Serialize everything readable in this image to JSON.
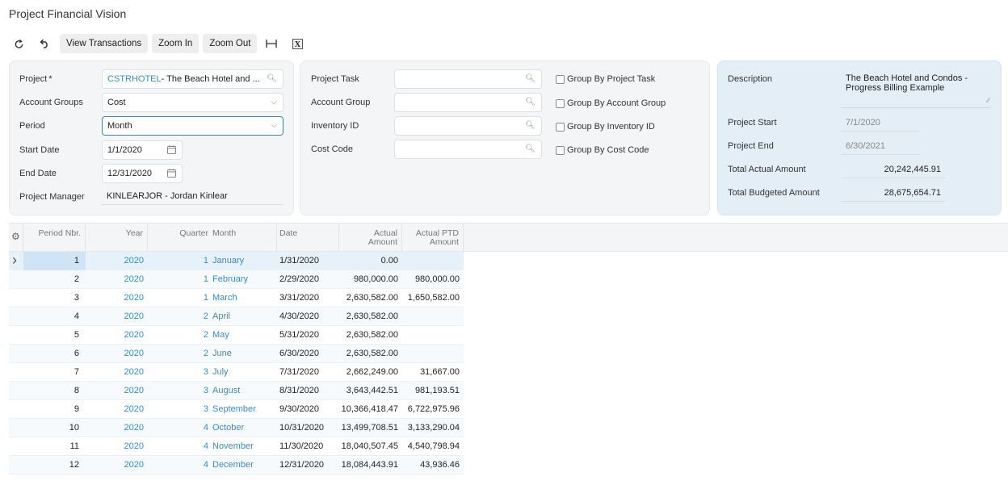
{
  "page": {
    "title": "Project Financial Vision"
  },
  "toolbar": {
    "refresh_icon": "refresh-icon",
    "undo_icon": "undo-icon",
    "view_transactions": "View Transactions",
    "zoom_in": "Zoom In",
    "zoom_out": "Zoom Out",
    "fit_icon": "fit-width-icon",
    "excel_icon": "excel-export-icon"
  },
  "filters": {
    "project": {
      "label": "Project",
      "required_mark": "*",
      "code": "CSTRHOTEL",
      "desc": " - The Beach Hotel and ...",
      "icon": "search-icon"
    },
    "account_groups": {
      "label": "Account Groups",
      "value": "Cost"
    },
    "period": {
      "label": "Period",
      "value": "Month"
    },
    "start_date": {
      "label": "Start Date",
      "value": "1/1/2020"
    },
    "end_date": {
      "label": "End Date",
      "value": "12/31/2020"
    },
    "project_manager": {
      "label": "Project Manager",
      "value": "KINLEARJOR - Jordan Kinlear"
    }
  },
  "lookups": {
    "project_task": {
      "label": "Project Task",
      "value": "",
      "group_label": "Group By Project Task",
      "checked": false
    },
    "account_group": {
      "label": "Account Group",
      "value": "",
      "group_label": "Group By Account Group",
      "checked": false
    },
    "inventory_id": {
      "label": "Inventory ID",
      "value": "",
      "group_label": "Group By Inventory ID",
      "checked": false
    },
    "cost_code": {
      "label": "Cost Code",
      "value": "",
      "group_label": "Group By Cost Code",
      "checked": false
    }
  },
  "summary": {
    "description": {
      "label": "Description",
      "value": "The Beach Hotel and Condos - Progress Billing Example"
    },
    "project_start": {
      "label": "Project Start",
      "value": "7/1/2020"
    },
    "project_end": {
      "label": "Project End",
      "value": "6/30/2021"
    },
    "total_actual": {
      "label": "Total Actual Amount",
      "value": "20,242,445.91"
    },
    "total_budgeted": {
      "label": "Total Budgeted Amount",
      "value": "28,675,654.71"
    }
  },
  "grid": {
    "columns": {
      "period_nbr": "Period Nbr.",
      "year": "Year",
      "quarter": "Quarter",
      "month": "Month",
      "date": "Date",
      "actual_amount_1": "Actual",
      "actual_amount_2": "Amount",
      "actual_ptd_1": "Actual PTD",
      "actual_ptd_2": "Amount"
    },
    "rows": [
      {
        "period": "1",
        "year": "2020",
        "quarter": "1",
        "month": "January",
        "date": "1/31/2020",
        "actual": "0.00",
        "ptd": ""
      },
      {
        "period": "2",
        "year": "2020",
        "quarter": "1",
        "month": "February",
        "date": "2/29/2020",
        "actual": "980,000.00",
        "ptd": "980,000.00"
      },
      {
        "period": "3",
        "year": "2020",
        "quarter": "1",
        "month": "March",
        "date": "3/31/2020",
        "actual": "2,630,582.00",
        "ptd": "1,650,582.00"
      },
      {
        "period": "4",
        "year": "2020",
        "quarter": "2",
        "month": "April",
        "date": "4/30/2020",
        "actual": "2,630,582.00",
        "ptd": ""
      },
      {
        "period": "5",
        "year": "2020",
        "quarter": "2",
        "month": "May",
        "date": "5/31/2020",
        "actual": "2,630,582.00",
        "ptd": ""
      },
      {
        "period": "6",
        "year": "2020",
        "quarter": "2",
        "month": "June",
        "date": "6/30/2020",
        "actual": "2,630,582.00",
        "ptd": ""
      },
      {
        "period": "7",
        "year": "2020",
        "quarter": "3",
        "month": "July",
        "date": "7/31/2020",
        "actual": "2,662,249.00",
        "ptd": "31,667.00"
      },
      {
        "period": "8",
        "year": "2020",
        "quarter": "3",
        "month": "August",
        "date": "8/31/2020",
        "actual": "3,643,442.51",
        "ptd": "981,193.51"
      },
      {
        "period": "9",
        "year": "2020",
        "quarter": "3",
        "month": "September",
        "date": "9/30/2020",
        "actual": "10,366,418.47",
        "ptd": "6,722,975.96"
      },
      {
        "period": "10",
        "year": "2020",
        "quarter": "4",
        "month": "October",
        "date": "10/31/2020",
        "actual": "13,499,708.51",
        "ptd": "3,133,290.04"
      },
      {
        "period": "11",
        "year": "2020",
        "quarter": "4",
        "month": "November",
        "date": "11/30/2020",
        "actual": "18,040,507.45",
        "ptd": "4,540,798.94"
      },
      {
        "period": "12",
        "year": "2020",
        "quarter": "4",
        "month": "December",
        "date": "12/31/2020",
        "actual": "18,084,443.91",
        "ptd": "43,936.46"
      }
    ]
  }
}
